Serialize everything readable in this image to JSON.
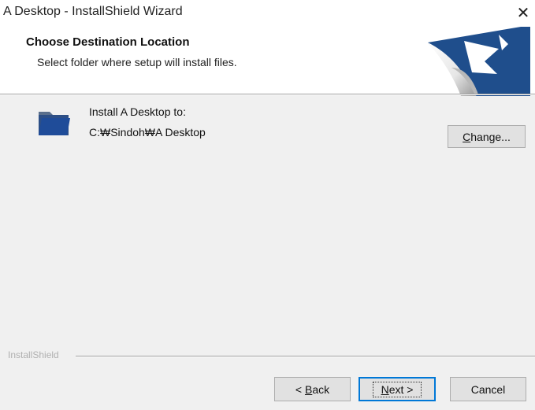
{
  "window": {
    "title": "A Desktop - InstallShield Wizard",
    "close_glyph": "✕"
  },
  "header": {
    "title": "Choose Destination Location",
    "subtitle": "Select folder where setup will install files."
  },
  "body": {
    "install_label": "Install A Desktop to:",
    "install_path": "C:₩Sindoh₩A Desktop",
    "change_prefix": "",
    "change_mnemonic": "C",
    "change_rest": "hange..."
  },
  "footer": {
    "brand": "InstallShield",
    "back": {
      "prefix": "< ",
      "mnemonic": "B",
      "rest": "ack"
    },
    "next": {
      "prefix": "",
      "mnemonic": "N",
      "rest": "ext >"
    },
    "cancel": "Cancel"
  },
  "colors": {
    "accent": "#0078d7",
    "logo_blue": "#1f4e8c"
  }
}
